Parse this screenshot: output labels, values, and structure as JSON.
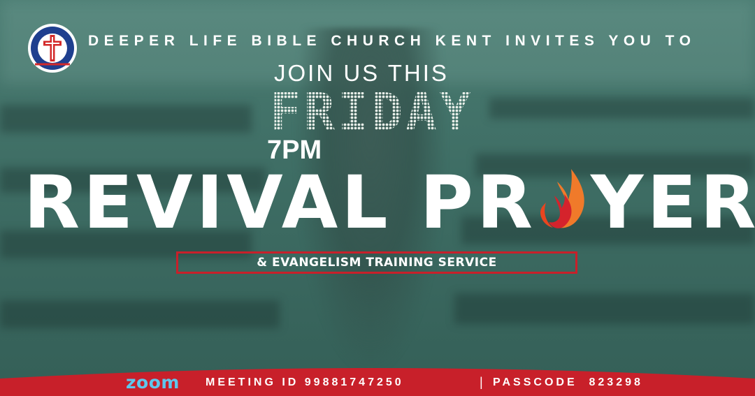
{
  "header": {
    "logo_text": "DEEPER LIFE BIBLE CHURCH",
    "invite_line": "DEEPER LIFE BIBLE CHURCH KENT INVITES YOU TO"
  },
  "event": {
    "intro": "JOIN US THIS",
    "day": "FRIDAY",
    "time": "7PM",
    "title_part1": "REVIVAL PR",
    "title_part2": "YER",
    "subtitle": "& EVANGELISM TRAINING SERVICE"
  },
  "footer": {
    "platform": "ZOOM",
    "meeting_label": "MEETING ID 99881747250",
    "divider": "|",
    "passcode_label": "PASSCODE  823298"
  },
  "colors": {
    "background": "#3f6f66",
    "accent_red": "#c8202a",
    "zoom_blue": "#5fc6ec",
    "flame_orange": "#f07a2a"
  },
  "icons": [
    "church-logo-icon",
    "flame-icon"
  ]
}
